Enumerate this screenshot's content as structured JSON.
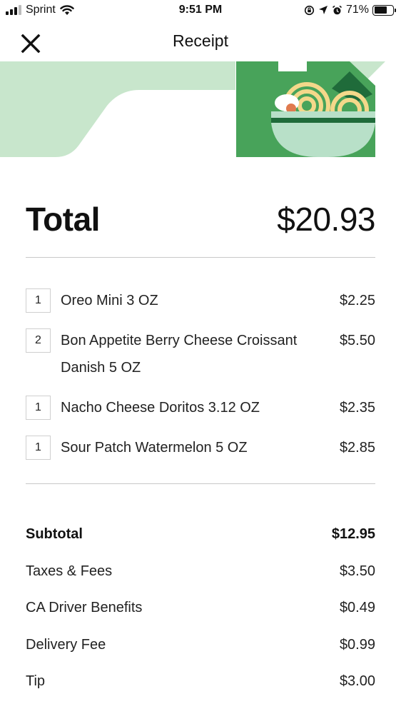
{
  "status_bar": {
    "carrier": "Sprint",
    "time": "9:51 PM",
    "battery": "71%",
    "battery_level": 0.71
  },
  "header": {
    "title": "Receipt"
  },
  "colors": {
    "banner_light_green": "#c8e6cc",
    "banner_green": "#48a35a",
    "banner_dark_green": "#1f6b3a",
    "bowl_mint": "#b8e0c8",
    "noodle_yellow": "#f4d88a"
  },
  "total": {
    "label": "Total",
    "value": "$20.93"
  },
  "items": [
    {
      "qty": "1",
      "name": "Oreo Mini 3 OZ",
      "price": "$2.25"
    },
    {
      "qty": "2",
      "name": "Bon Appetite Berry Cheese Croissant Danish 5 OZ",
      "price": "$5.50"
    },
    {
      "qty": "1",
      "name": "Nacho Cheese Doritos 3.12 OZ",
      "price": "$2.35"
    },
    {
      "qty": "1",
      "name": "Sour Patch Watermelon 5 OZ",
      "price": "$2.85"
    }
  ],
  "summary": [
    {
      "label": "Subtotal",
      "value": "$12.95"
    },
    {
      "label": "Taxes & Fees",
      "value": "$3.50"
    },
    {
      "label": "CA Driver Benefits",
      "value": "$0.49"
    },
    {
      "label": "Delivery Fee",
      "value": "$0.99"
    },
    {
      "label": "Tip",
      "value": "$3.00"
    }
  ]
}
